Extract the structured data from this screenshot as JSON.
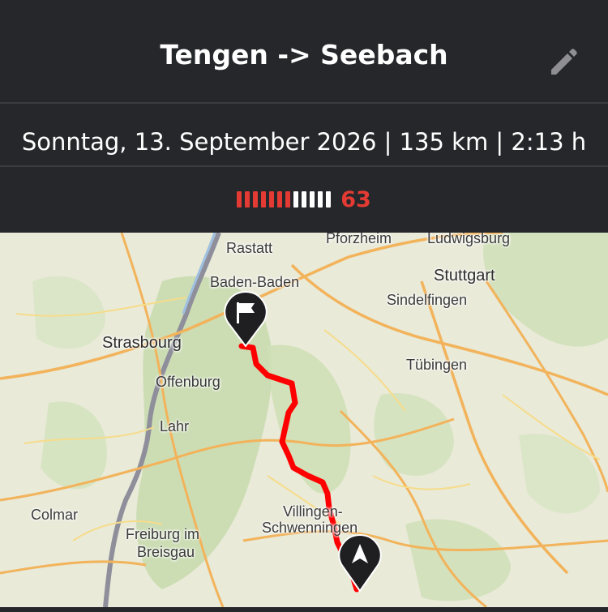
{
  "header": {
    "title": "Tengen -> Seebach",
    "edit_icon": "pencil-icon"
  },
  "info": {
    "summary": "Sonntag, 13. September 2026 | 135 km | 2:13 h"
  },
  "rating": {
    "value": "63",
    "filled_bars": 7,
    "total_bars": 12,
    "filled_color": "#e33b33",
    "empty_color": "#ffffff"
  },
  "map": {
    "route_color": "#ff0000",
    "start_marker_icon": "flag-icon",
    "end_marker_icon": "navigation-arrow-icon",
    "places": {
      "rastatt": "Rastatt",
      "pforzheim": "Pforzheim",
      "ludwigsburg": "Ludwigsburg",
      "baden_baden": "Baden-Baden",
      "stuttgart": "Stuttgart",
      "sindelfingen": "Sindelfingen",
      "strasbourg": "Strasbourg",
      "tuebingen": "Tübingen",
      "offenburg": "Offenburg",
      "lahr": "Lahr",
      "colmar": "Colmar",
      "villingen": "Villingen-",
      "schwenningen": "Schwenningen",
      "freiburg": "Freiburg im",
      "breisgau": "Breisgau"
    }
  }
}
